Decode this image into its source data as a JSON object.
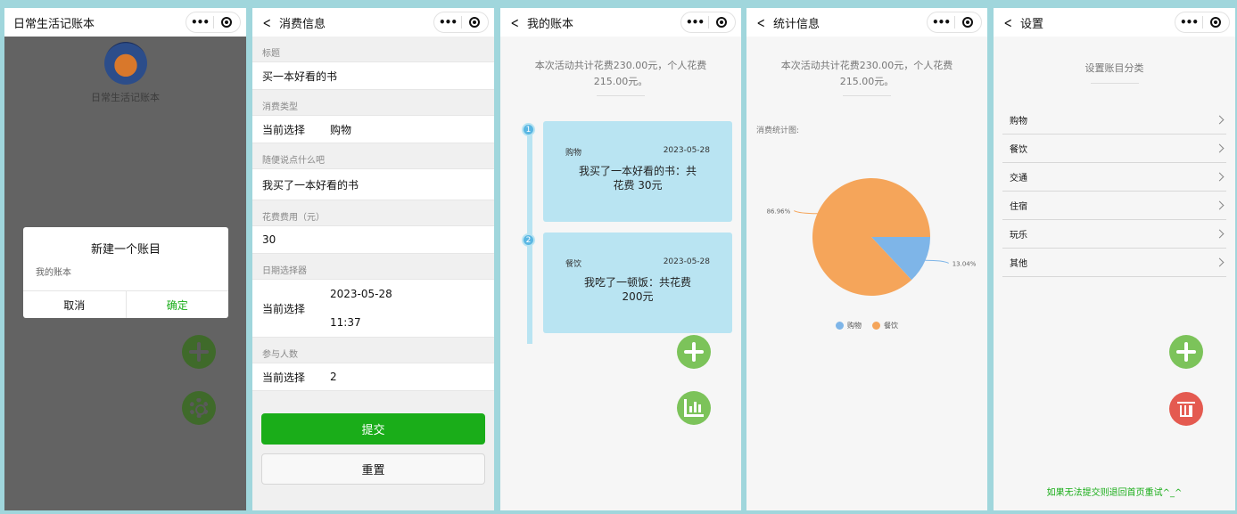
{
  "capsule": {
    "dots": "•••"
  },
  "screen1": {
    "nav_title": "日常生活记账本",
    "app_name": "日常生活记账本",
    "dialog": {
      "title": "新建一个账目",
      "input_value": "我的账本",
      "cancel": "取消",
      "confirm": "确定"
    }
  },
  "screen2": {
    "nav_title": "消费信息",
    "fields": {
      "title_label": "标题",
      "title_value": "买一本好看的书",
      "type_label": "消费类型",
      "type_prefix": "当前选择",
      "type_value": "购物",
      "note_label": "随便说点什么吧",
      "note_value": "我买了一本好看的书",
      "cost_label": "花费费用（元）",
      "cost_value": "30",
      "date_label": "日期选择器",
      "date_prefix": "当前选择",
      "date_value": "2023-05-28",
      "time_value": "11:37",
      "people_label": "参与人数",
      "people_prefix": "当前选择",
      "people_value": "2"
    },
    "submit": "提交",
    "reset": "重置"
  },
  "screen3": {
    "nav_title": "我的账本",
    "summary": "本次活动共计花费230.00元，个人花费215.00元。",
    "records": [
      {
        "num": "1",
        "type": "购物",
        "date": "2023-05-28",
        "desc": "我买了一本好看的书：共花费 30元"
      },
      {
        "num": "2",
        "type": "餐饮",
        "date": "2023-05-28",
        "desc": "我吃了一顿饭：共花费200元"
      }
    ]
  },
  "screen4": {
    "nav_title": "统计信息",
    "summary": "本次活动共计花费230.00元，个人花费215.00元。",
    "chart_label": "消费统计图:",
    "chart_data": {
      "type": "pie",
      "categories": [
        "购物",
        "餐饮"
      ],
      "values": [
        13.04,
        86.96
      ],
      "labels": [
        "13.04%",
        "86.96%"
      ],
      "colors": [
        "#7eb5e8",
        "#f5a55a"
      ],
      "legend": "bottom"
    }
  },
  "screen5": {
    "nav_title": "设置",
    "title": "设置账目分类",
    "categories": [
      "购物",
      "餐饮",
      "交通",
      "住宿",
      "玩乐",
      "其他"
    ],
    "footer": "如果无法提交则退回首页重试^_^"
  },
  "colors": {
    "primary_green": "#1aad19",
    "fab_green": "#7cc35a",
    "fab_red": "#e45a50",
    "card_blue": "#b9e4f2"
  }
}
